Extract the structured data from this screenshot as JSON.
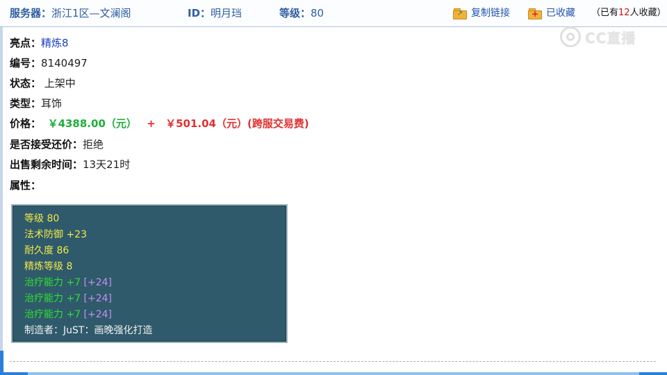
{
  "header": {
    "server_label": "服务器：",
    "server_value": "浙江1区—文澜阁",
    "id_label": "ID：",
    "id_value": "明月珰",
    "level_label": "等级：",
    "level_value": "80",
    "copy_link": "复制链接",
    "favorited": "已收藏",
    "fav_count_prefix": "（已有",
    "fav_count": "12",
    "fav_count_suffix": "人收藏）"
  },
  "watermark": {
    "text": "CC直播"
  },
  "details": {
    "highlight_label": "亮点：",
    "highlight_value": "精炼8",
    "number_label": "编号：",
    "number_value": "8140497",
    "status_label": "状态：",
    "status_value": "上架中",
    "type_label": "类型：",
    "type_value": "耳饰",
    "price_label": "价格：",
    "price_main": "￥4388.00（元）",
    "price_plus": "+",
    "price_fee": "￥501.04（元）(跨服交易费)",
    "counter_label": "是否接受还价：",
    "counter_value": "拒绝",
    "remaining_label": "出售剩余时间：",
    "remaining_value": "13天21时",
    "attributes_label": "属性："
  },
  "attributes": {
    "level": "等级 80",
    "magic_def": "法术防御 +23",
    "durability": "耐久度 86",
    "refine": "精炼等级 8",
    "heal_1": "治疗能力 +7",
    "heal_1_bonus": "[+24]",
    "heal_2": "治疗能力 +7",
    "heal_2_bonus": "[+24]",
    "heal_3": "治疗能力 +7",
    "heal_3_bonus": "[+24]",
    "maker": "制造者：JuST：画晚强化打造"
  },
  "colors": {
    "header_text": "#2f5ea0",
    "attr_bg": "#2f5a6b",
    "attr_yellow": "#f2e84a",
    "attr_green": "#2ee02e",
    "attr_purple": "#c48cf0",
    "price_green": "#1fae3a",
    "price_red": "#e03030"
  },
  "icons": {
    "copy": "folder-arrow-icon",
    "favorite": "folder-plus-icon",
    "watermark": "cc-logo-icon"
  }
}
